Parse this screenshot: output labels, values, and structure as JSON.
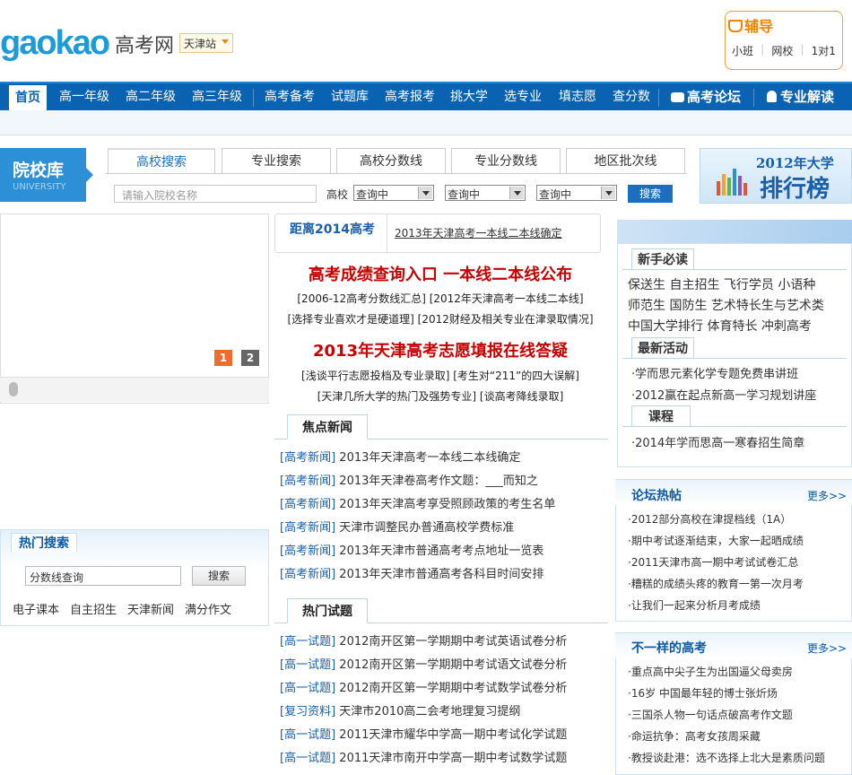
{
  "header": {
    "logo": "gaokao",
    "logo_cn": "高考网",
    "station": "天津站",
    "fudao": {
      "title": "辅导",
      "links": [
        "小班",
        "网校",
        "1对1"
      ]
    }
  },
  "nav": {
    "home": "首页",
    "items": [
      "高一年级",
      "高二年级",
      "高三年级",
      "高考备考",
      "试题库",
      "高考报考",
      "挑大学",
      "选专业",
      "填志愿",
      "查分数"
    ],
    "forum": "高考论坛",
    "expert": "专业解读"
  },
  "school_search": {
    "title": "院校库",
    "subtitle": "UNIVERSITY",
    "tabs": [
      "高校搜索",
      "专业搜索",
      "高校分数线",
      "专业分数线",
      "地区批次线"
    ],
    "input_placeholder": "请输入院校名称",
    "school_label": "高校",
    "selects": [
      "查询中",
      "查询中",
      "查询中"
    ],
    "button": "搜索",
    "rank_banner": {
      "year": "2012年大学",
      "name": "排行榜"
    }
  },
  "slider": {
    "pages": [
      "1",
      "2"
    ]
  },
  "hot_search": {
    "title": "热门搜索",
    "input_value": "分数线查询",
    "button": "搜索",
    "links": [
      "电子课本",
      "自主招生",
      "天津新闻",
      "满分作文"
    ]
  },
  "countdown": {
    "label": "距离2014高考",
    "news": "2013年天津高考一本线二本线确定"
  },
  "headlines": [
    {
      "title": "高考成绩查询入口 一本线二本线公布",
      "lines": [
        "[2006-12高考分数线汇总] [2012年天津高考一本线二本线]",
        "[选择专业喜欢才是硬道理] [2012财经及相关专业在津录取情况]"
      ]
    },
    {
      "title": "2013年天津高考志愿填报在线答疑",
      "lines": [
        "[浅谈平行志愿投档及专业录取] [考生对“211”的四大误解]",
        "[天津几所大学的热门及强势专业] [谈高考降线录取]"
      ]
    }
  ],
  "focus_news": {
    "title": "焦点新闻",
    "items": [
      {
        "tag": "[高考新闻]",
        "text": "2013年天津高考一本线二本线确定"
      },
      {
        "tag": "[高考新闻]",
        "text": "2013年天津卷高考作文题：___而知之"
      },
      {
        "tag": "[高考新闻]",
        "text": "2013年天津高考享受照顾政策的考生名单"
      },
      {
        "tag": "[高考新闻]",
        "text": "天津市调整民办普通高校学费标准"
      },
      {
        "tag": "[高考新闻]",
        "text": "2013年天津市普通高考考点地址一览表"
      },
      {
        "tag": "[高考新闻]",
        "text": "2013年天津市普通高考各科目时间安排"
      }
    ]
  },
  "hot_exams": {
    "title": "热门试题",
    "items": [
      {
        "tag": "[高一试题]",
        "text": "2012南开区第一学期期中考试英语试卷分析"
      },
      {
        "tag": "[高一试题]",
        "text": "2012南开区第一学期期中考试语文试卷分析"
      },
      {
        "tag": "[高一试题]",
        "text": "2012南开区第一学期期中考试数学试卷分析"
      },
      {
        "tag": "[复习资料]",
        "text": "天津市2010高二会考地理复习提纲"
      },
      {
        "tag": "[高一试题]",
        "text": "2011天津市耀华中学高一期中考试化学试题"
      },
      {
        "tag": "[高一试题]",
        "text": "2011天津市南开中学高一期中考试数学试题"
      }
    ]
  },
  "newbie": {
    "title": "新手必读",
    "rows": [
      "保送生  自主招生  飞行学员  小语种",
      "师范生  国防生  艺术特长生与艺术类",
      "中国大学排行  体育特长  冲刺高考"
    ]
  },
  "latest": {
    "title": "最新活动",
    "items": [
      "·学而思元素化学专题免费串讲班",
      "·2012赢在起点新高一学习规划讲座"
    ]
  },
  "course": {
    "title": "课程",
    "items": [
      "·2014年学而思高一寒春招生简章"
    ]
  },
  "forum_hot": {
    "title": "论坛热帖",
    "more": "更多>>",
    "items": [
      "·2012部分高校在津提档线（1A）",
      "·期中考试逐渐结束，大家一起晒成绩",
      "·2011天津市高一期中考试试卷汇总",
      "·糟糕的成绩头疼的教育一第一次月考",
      "·让我们一起来分析月考成绩"
    ]
  },
  "different": {
    "title": "不一样的高考",
    "more": "更多>>",
    "items": [
      "·重点高中尖子生为出国逼父母卖房",
      "·16岁  中国最年轻的博士张炘炀",
      "·三国杀人物一句话点破高考作文题",
      "·命运抗争：高考女孩周采藏",
      "·教授谈赴港：选不选择上北大是素质问题"
    ]
  }
}
